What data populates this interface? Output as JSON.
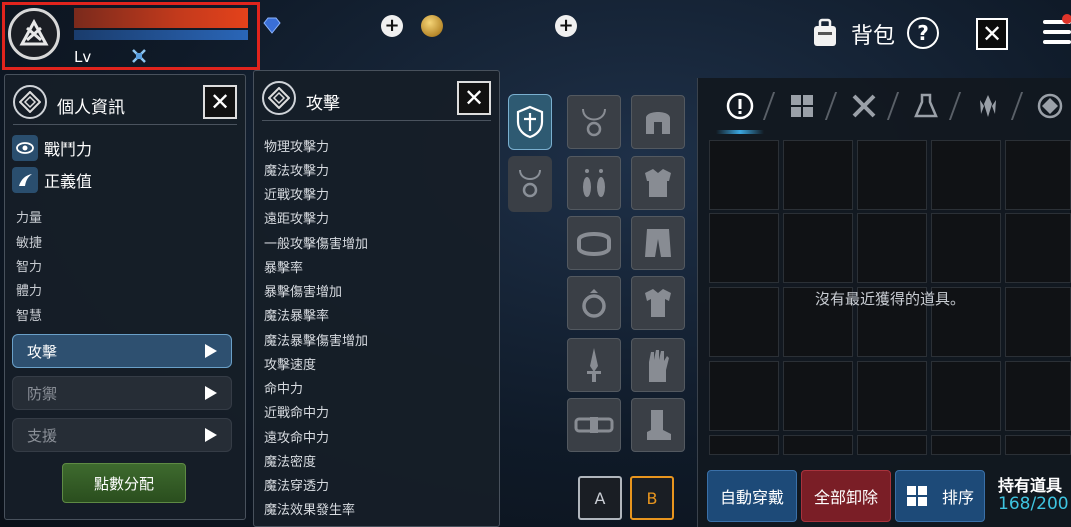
{
  "player": {
    "level_label": "Lv"
  },
  "bag": {
    "title": "背包",
    "help": "?",
    "close": "✕"
  },
  "info_panel": {
    "title": "個人資訊",
    "combat_power": "戰鬥力",
    "justice": "正義值",
    "attributes": [
      "力量",
      "敏捷",
      "智力",
      "體力",
      "智慧"
    ],
    "tabs": [
      "攻擊",
      "防禦",
      "支援"
    ],
    "allocate_button": "點數分配"
  },
  "attack_panel": {
    "title": "攻擊",
    "items": [
      "物理攻擊力",
      "魔法攻擊力",
      "近戰攻擊力",
      "遠距攻擊力",
      "一般攻擊傷害增加",
      "暴擊率",
      "暴擊傷害增加",
      "魔法暴擊率",
      "魔法暴擊傷害增加",
      "攻擊速度",
      "命中力",
      "近戰命中力",
      "遠攻命中力",
      "魔法密度",
      "魔法穿透力",
      "魔法效果發生率"
    ]
  },
  "equipment": {
    "preset_a": "A",
    "preset_b": "B"
  },
  "inventory": {
    "empty_message": "沒有最近獲得的道具。",
    "auto_equip": "自動穿戴",
    "unequip_all": "全部卸除",
    "sort": "排序",
    "hold_label": "持有道具",
    "hold_count": "168/200"
  }
}
